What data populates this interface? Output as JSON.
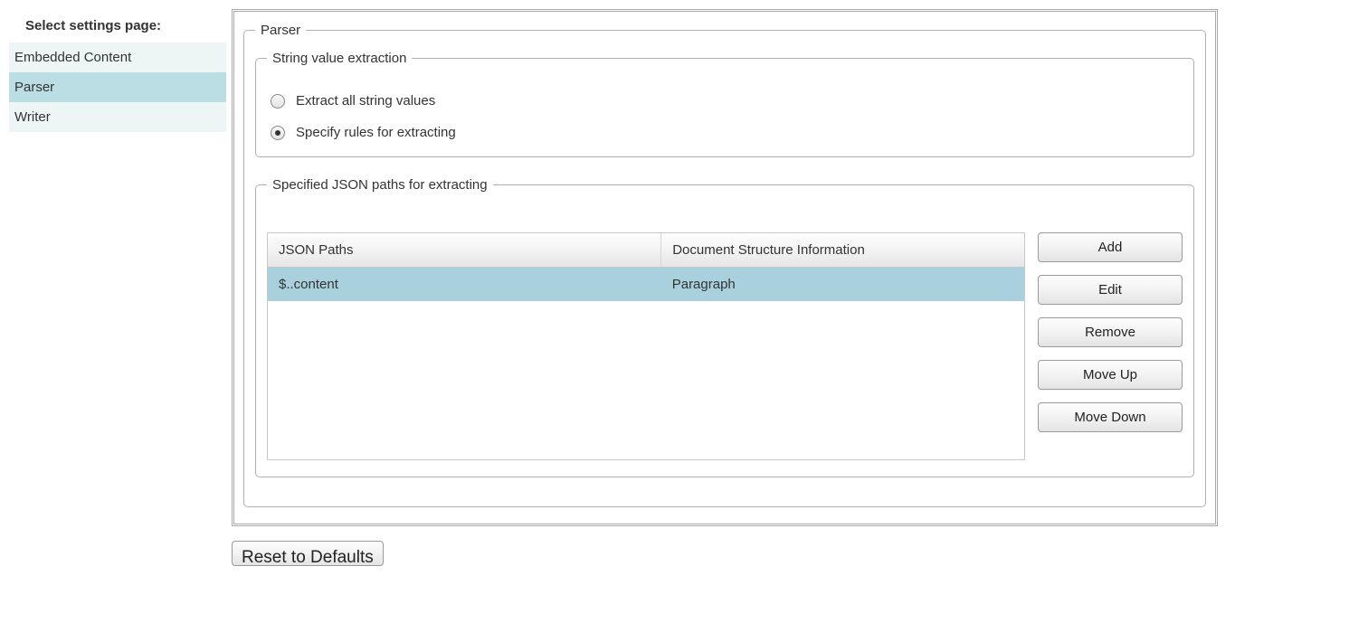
{
  "sidebar": {
    "title": "Select settings page:",
    "items": [
      {
        "label": "Embedded Content",
        "selected": false
      },
      {
        "label": "Parser",
        "selected": true
      },
      {
        "label": "Writer",
        "selected": false
      }
    ]
  },
  "parser": {
    "legend": "Parser",
    "stringExtraction": {
      "legend": "String value extraction",
      "options": {
        "extractAll": "Extract all string values",
        "specifyRules": "Specify rules for extracting"
      },
      "selected": "specifyRules"
    },
    "jsonPaths": {
      "legend": "Specified JSON paths for extracting",
      "columns": {
        "path": "JSON Paths",
        "structure": "Document Structure Information"
      },
      "rows": [
        {
          "path": "$..content",
          "structure": "Paragraph",
          "selected": true
        }
      ],
      "buttons": {
        "add": "Add",
        "edit": "Edit",
        "remove": "Remove",
        "moveUp": "Move Up",
        "moveDown": "Move Down"
      }
    }
  },
  "footer": {
    "reset": "Reset to Defaults"
  }
}
